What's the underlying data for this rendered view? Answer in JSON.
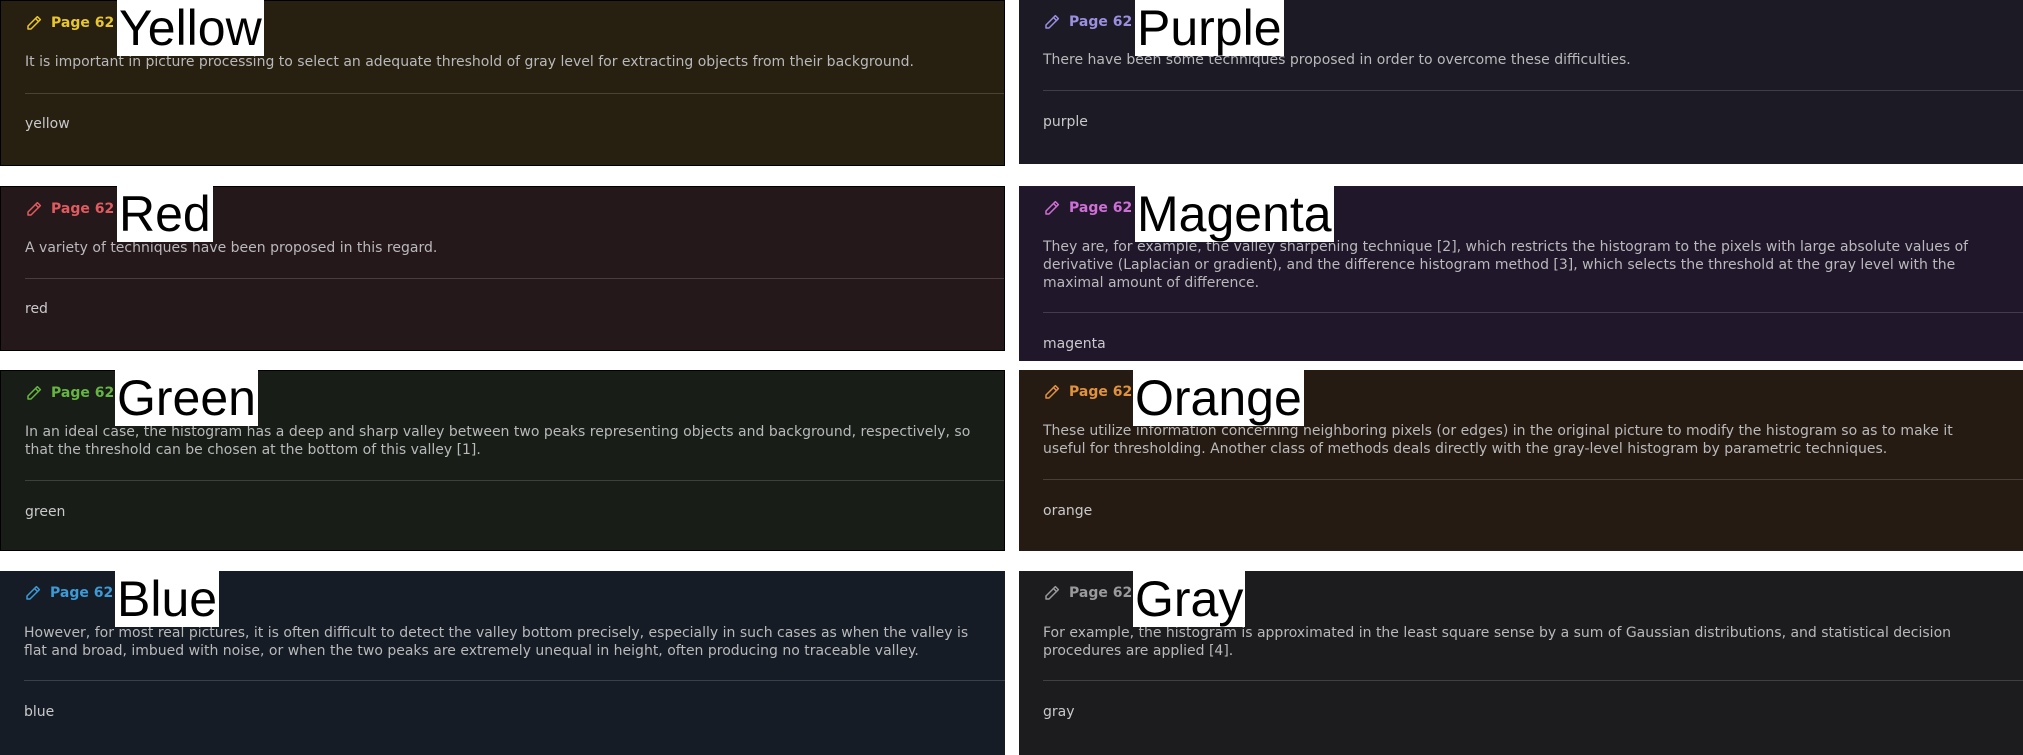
{
  "cards": [
    {
      "color_name": "Yellow",
      "page": "Page 62",
      "accent": "#e8c62e",
      "bg": "#271f10",
      "quote": "It is important in picture processing to select an adequate threshold of gray level for extracting objects from their background.",
      "note": "yellow"
    },
    {
      "color_name": "Purple",
      "page": "Page 62",
      "accent": "#9b8fe0",
      "bg": "#1b1a25",
      "quote": "There have been some techniques proposed in order to overcome these difficulties.",
      "note": "purple"
    },
    {
      "color_name": "Red",
      "page": "Page 62",
      "accent": "#e05b60",
      "bg": "#25181b",
      "quote": "A variety of techniques have been proposed in this regard.",
      "note": "red"
    },
    {
      "color_name": "Magenta",
      "page": "Page 62",
      "accent": "#cf6fd5",
      "bg": "#21172b",
      "quote": "They are, for example, the valley sharpening technique [2], which restricts the histogram to the pixels with large absolute values of derivative (Laplacian or gradient), and the difference histogram method [3], which selects the threshold at the gray level with the maximal amount of difference.",
      "note": "magenta"
    },
    {
      "color_name": "Green",
      "page": "Page 62",
      "accent": "#66b540",
      "bg": "#181d17",
      "quote": "In an ideal case, the histogram has a deep and sharp valley between two peaks representing objects and background, respectively, so that the threshold can be chosen at the bottom of this valley [1].",
      "note": "green"
    },
    {
      "color_name": "Orange",
      "page": "Page 62",
      "accent": "#e0923c",
      "bg": "#261b12",
      "quote": "These utilize information concerning neighboring pixels (or edges) in the original picture to modify the histogram so as to make it useful for thresholding. Another class of methods deals directly with the gray-level histogram by parametric techniques.",
      "note": "orange"
    },
    {
      "color_name": "Blue",
      "page": "Page 62",
      "accent": "#3c9ad6",
      "bg": "#151c25",
      "quote": "However, for most real pictures, it is often difficult to detect the valley bottom precisely, especially in such cases as when the valley is flat and broad, imbued with noise, or when the two peaks are extremely unequal in height, often producing no traceable valley.",
      "note": "blue"
    },
    {
      "color_name": "Gray",
      "page": "Page 62",
      "accent": "#9a9a9d",
      "bg": "#1c1c1f",
      "quote": "For example, the histogram is approximated in the least square sense by a sum of Gaussian distributions, and statistical decision procedures are applied [4].",
      "note": "gray"
    }
  ]
}
